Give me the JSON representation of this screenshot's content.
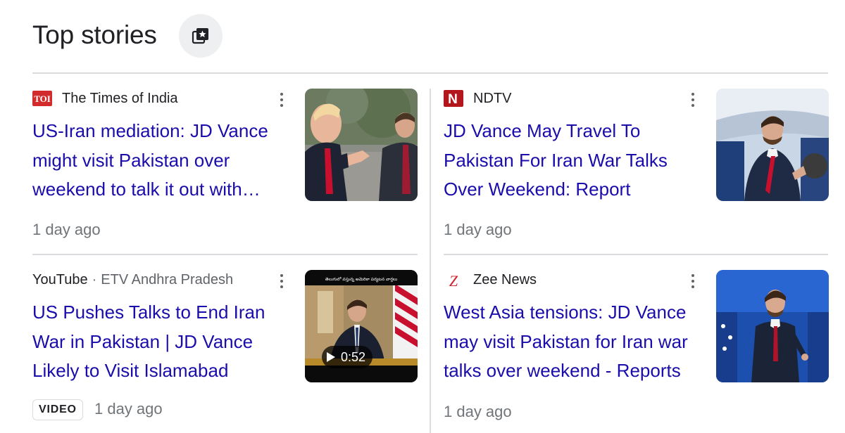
{
  "header": {
    "title": "Top stories",
    "button_icon": "star-collection-icon"
  },
  "stories": [
    {
      "source": "The Times of India",
      "source_sub": "",
      "logo_text": "TOI",
      "logo_color": "#d22b2b",
      "title_lines": [
        "US-Iran mediation: JD Vance",
        "might visit Pakistan over",
        "weekend to talk it out with…"
      ],
      "time": "1 day ago"
    },
    {
      "source": "NDTV",
      "source_sub": "",
      "logo_text": "N",
      "logo_color": "#b3171c",
      "title_lines": [
        "JD Vance May Travel To",
        "Pakistan For Iran War Talks",
        "Over Weekend: Report"
      ],
      "time": "1 day ago"
    },
    {
      "source": "YouTube",
      "source_sub": "ETV Andhra Pradesh",
      "separator": "·",
      "title_lines": [
        "US Pushes Talks to End Iran",
        "War in Pakistan | JD Vance",
        "Likely to Visit Islamabad"
      ],
      "badge": "VIDEO",
      "time": "1 day ago",
      "duration": "0:52",
      "banner_text": "తెలుగులో వస్తున్న అమెరికా పర్యటన వార్తలు"
    },
    {
      "source": "Zee News",
      "source_sub": "",
      "logo_text": "Z",
      "logo_color": "#d0222e",
      "title_lines": [
        "West Asia tensions: JD Vance",
        "may visit Pakistan for Iran war",
        "talks over weekend - Reports"
      ],
      "time": "1 day ago"
    }
  ],
  "colors": {
    "link": "#1a0dab",
    "meta": "#70757a",
    "divider": "#dadce0"
  }
}
